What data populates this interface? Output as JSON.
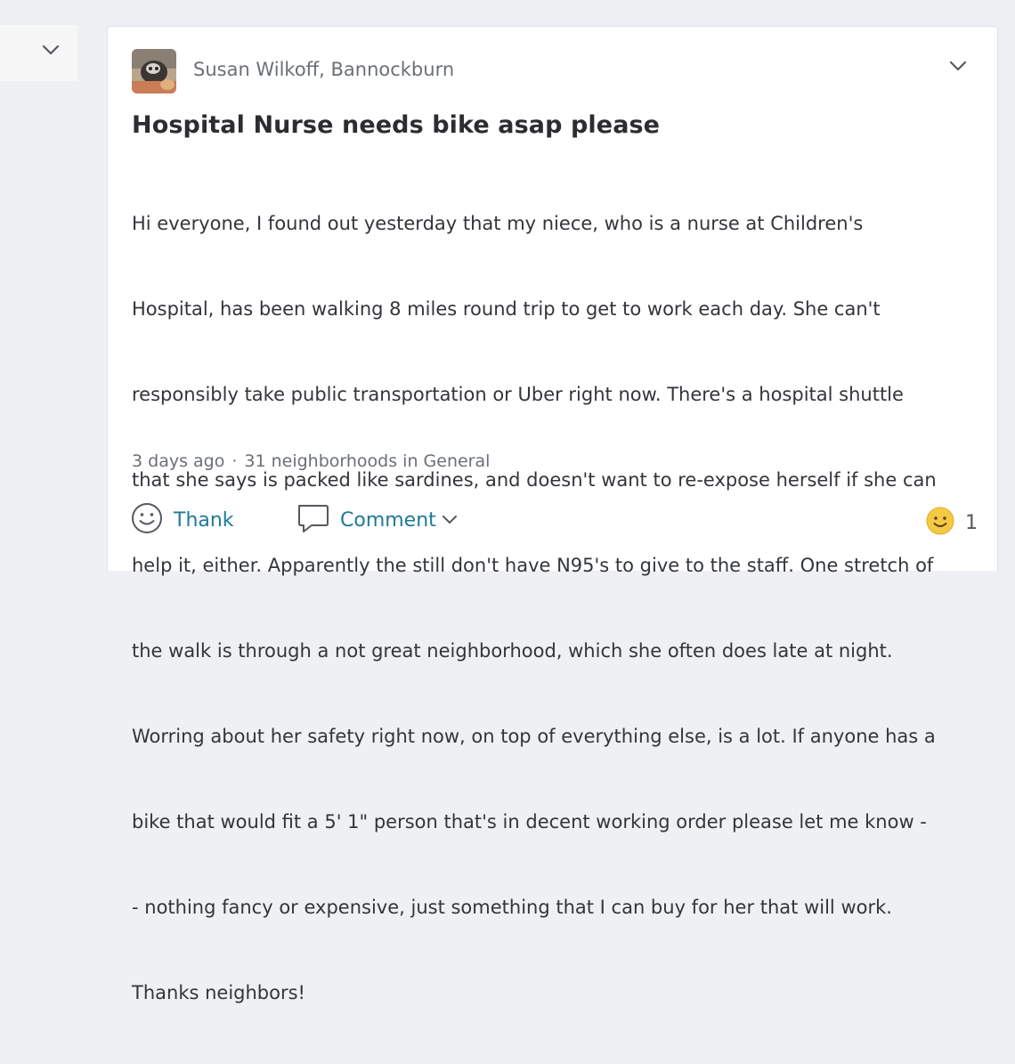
{
  "post": {
    "author": "Susan Wilkoff, Bannockburn",
    "title": "Hospital Nurse needs bike asap please",
    "body_lines": [
      "Hi everyone, I found out yesterday that my niece, who is a nurse at Children's",
      "Hospital, has been walking 8 miles round trip to get to work each day. She can't",
      "responsibly take public transportation or Uber right now. There's a hospital shuttle",
      "that she says is packed like sardines, and doesn't want to re-expose herself if she can",
      "help it, either. Apparently the still don't have N95's to give to the staff. One stretch of",
      "the walk is through a not great neighborhood, which she often does late at night.",
      "Worring about her safety right now, on top of everything else, is a lot. If anyone has a",
      "bike that would fit a 5' 1\" person that's in decent working order please let me know -",
      "- nothing fancy or expensive, just something that I can buy for her that will work.",
      "Thanks neighbors!"
    ],
    "timestamp": "3 days ago",
    "separator": "·",
    "audience": "31 neighborhoods in General"
  },
  "actions": {
    "thank_label": "Thank",
    "comment_label": "Comment",
    "reaction_count": "1"
  },
  "icons": {
    "left_chevron": "chevron-down-icon",
    "menu_chevron": "chevron-down-icon",
    "thank": "smiley-outline-icon",
    "comment": "speech-bubble-icon",
    "reaction": "smiley-emoji-icon"
  },
  "colors": {
    "accent": "#1e7a96",
    "muted_text": "#6b6f76",
    "background": "#eff0f3",
    "emoji_yellow": "#f6c945"
  }
}
